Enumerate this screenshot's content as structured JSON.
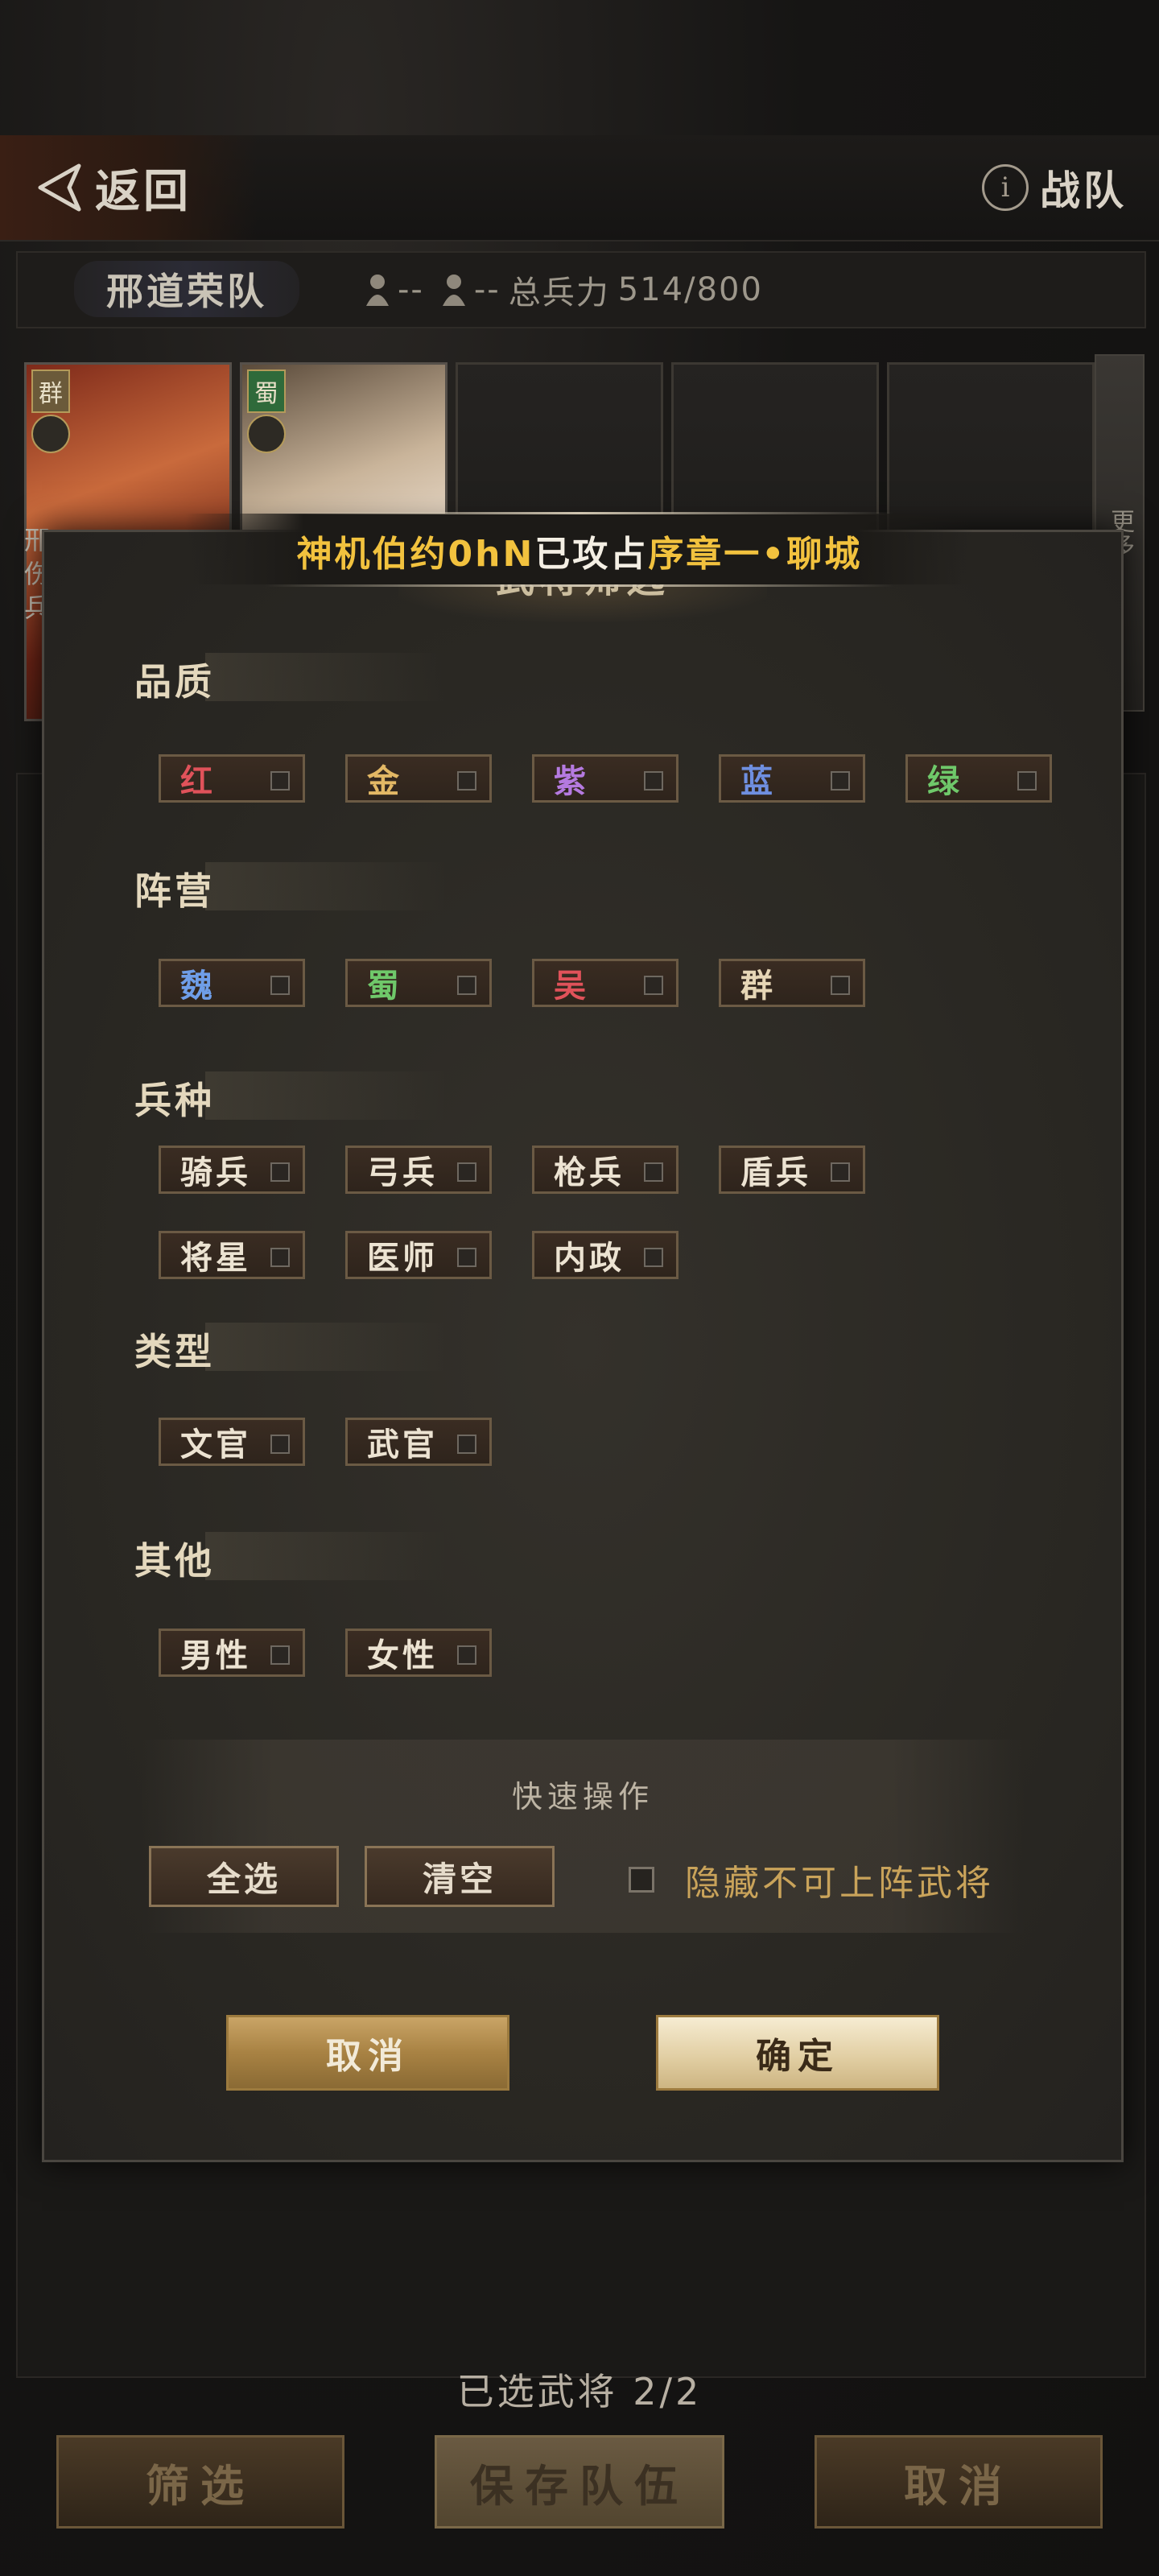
{
  "topbar": {
    "back_label": "返回",
    "team_label": "战队",
    "info_glyph": "i"
  },
  "team": {
    "name": "邢道荣队",
    "stat_a": "--",
    "stat_b": "--",
    "troops_label": "总兵力",
    "troops_value": "514/800"
  },
  "heroes": [
    {
      "faction": "群"
    },
    {
      "faction": "蜀"
    }
  ],
  "peek_text": "邢 伤 兵",
  "more_label": "更多",
  "notice": {
    "part1": "神机伯约0hN",
    "part2": "已攻占",
    "part3": "序章一•聊城"
  },
  "modal": {
    "title": "武将筛选",
    "sections": {
      "quality": {
        "label": "品质",
        "options": [
          "红",
          "金",
          "紫",
          "蓝",
          "绿"
        ]
      },
      "camp": {
        "label": "阵营",
        "options": [
          "魏",
          "蜀",
          "吴",
          "群"
        ]
      },
      "troop": {
        "label": "兵种",
        "options": [
          "骑兵",
          "弓兵",
          "枪兵",
          "盾兵",
          "将星",
          "医师",
          "内政"
        ]
      },
      "type": {
        "label": "类型",
        "options": [
          "文官",
          "武官"
        ]
      },
      "other": {
        "label": "其他",
        "options": [
          "男性",
          "女性"
        ]
      }
    },
    "option_colors": {
      "红": "#e0525a",
      "金": "#e3b865",
      "紫": "#b57ae0",
      "蓝": "#6f8fe0",
      "绿": "#6fc86a",
      "魏": "#6f9ee8",
      "蜀": "#6fc86a",
      "吴": "#e0525a",
      "群": "#e6d6b6",
      "default": "#ece3d2"
    },
    "quick": {
      "title": "快速操作",
      "select_all": "全选",
      "clear": "清空",
      "hide_label": "隐藏不可上阵武将"
    },
    "cancel_label": "取消",
    "confirm_label": "确定"
  },
  "bottom": {
    "selected_label": "已选武将 2/2",
    "filter_label": "筛选",
    "save_label": "保存队伍",
    "cancel_label": "取消"
  }
}
